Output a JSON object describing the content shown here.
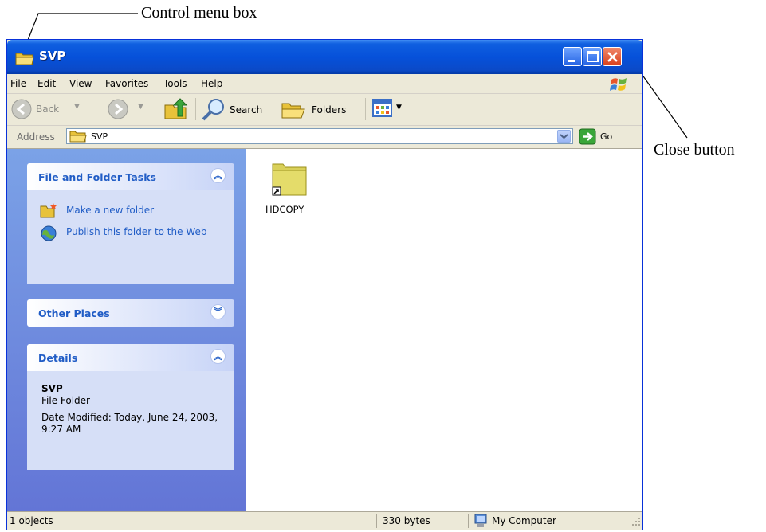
{
  "callouts": {
    "control_menu_box": "Control menu box",
    "close_button": "Close button"
  },
  "window": {
    "title": "SVP",
    "menu": [
      "File",
      "Edit",
      "View",
      "Favorites",
      "Tools",
      "Help"
    ],
    "toolbar": {
      "back": "Back",
      "search": "Search",
      "folders": "Folders"
    },
    "address": {
      "label": "Address",
      "value": "SVP",
      "go": "Go"
    },
    "tasks_panel": {
      "title": "File and Folder Tasks",
      "items": [
        "Make a new folder",
        "Publish this folder to the Web"
      ]
    },
    "other_places": {
      "title": "Other Places"
    },
    "details": {
      "title": "Details",
      "name": "SVP",
      "type": "File Folder",
      "modified": "Date Modified: Today, June 24, 2003, 9:27 AM"
    },
    "files": [
      {
        "name": "HDCOPY",
        "icon": "folder-shortcut-icon"
      }
    ],
    "status": {
      "objects": "1 objects",
      "size": "330 bytes",
      "location": "My Computer"
    }
  },
  "colors": {
    "titlebar": "#0651da",
    "taskpane": "#7ba2e7",
    "link": "#215dc6",
    "close": "#d8401c"
  }
}
